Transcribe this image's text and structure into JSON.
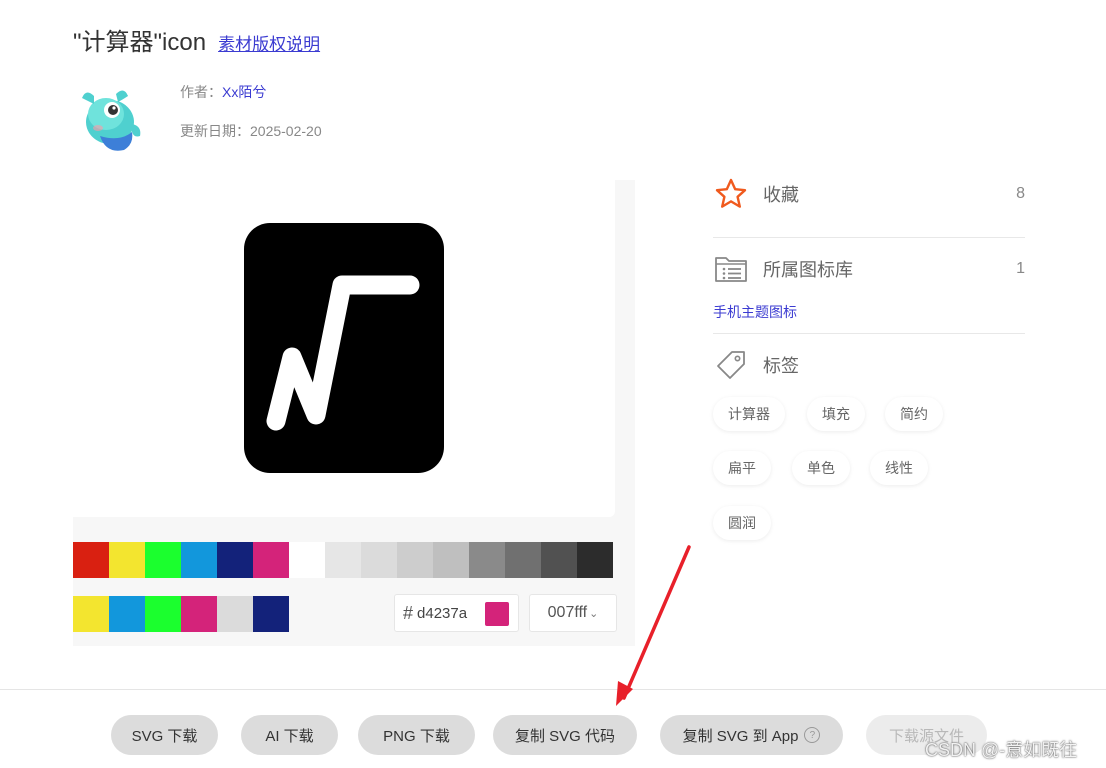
{
  "header": {
    "title": "\"计算器\"icon",
    "copyright_link": "素材版权说明"
  },
  "author": {
    "label": "作者：",
    "name": "Xx陌兮",
    "date_label": "更新日期：",
    "date": "2025-02-20"
  },
  "preview": {
    "icon_fill": "#000000",
    "icon_stroke": "#ffffff"
  },
  "palette": {
    "row1": [
      "#d92011",
      "#f3e52f",
      "#1bff2e",
      "#1297dc",
      "#13227a",
      "#d4237a",
      "#ffffff",
      "#e6e6e6",
      "#dbdbdb",
      "#cdcdcd",
      "#bfbfbf",
      "#8a8a8a",
      "#707070",
      "#515151",
      "#2c2c2c"
    ],
    "row2": [
      "#f3e52f",
      "#1297dc",
      "#1bff2e",
      "#d4237a",
      "#dbdbdb",
      "#13227a"
    ]
  },
  "color_input": {
    "hash": "#",
    "value": "d4237a",
    "swatch": "#d4237a"
  },
  "color_select": {
    "value": "007fff",
    "chevron": "⌄"
  },
  "sidebar": {
    "favorite": {
      "label": "收藏",
      "count": "8",
      "icon": "star-icon",
      "icon_color": "#f05a1e"
    },
    "library": {
      "label": "所属图标库",
      "count": "1",
      "icon": "folder-list-icon",
      "link": "手机主题图标"
    },
    "tags": {
      "label": "标签",
      "icon": "tag-icon",
      "items": [
        "计算器",
        "填充",
        "简约",
        "扁平",
        "单色",
        "线性",
        "圆润"
      ]
    }
  },
  "actions": {
    "svg_download": "SVG 下载",
    "ai_download": "AI 下载",
    "png_download": "PNG 下载",
    "copy_svg_code": "复制 SVG 代码",
    "copy_svg_to_app": "复制 SVG 到 App",
    "help": "?",
    "download_source": "下载源文件"
  },
  "annotation": {
    "arrow_color": "#e8202a"
  },
  "watermark": "CSDN @-意如既往"
}
